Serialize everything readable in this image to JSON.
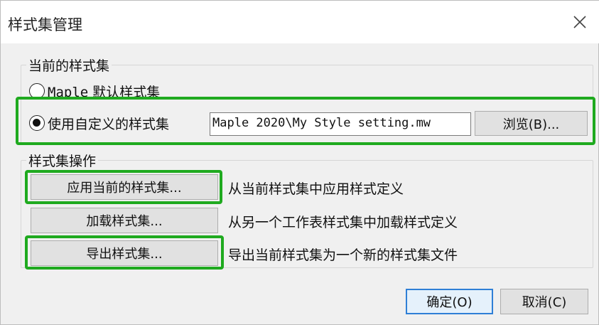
{
  "window": {
    "title": "样式集管理"
  },
  "current_style_set": {
    "group_label": "当前的样式集",
    "options": [
      {
        "label_prefix": "Maple",
        "label_suffix": " 默认样式集",
        "checked": false
      },
      {
        "label": "使用自定义的样式集",
        "checked": true
      }
    ],
    "path_value": "Maple 2020\\My Style setting.mw",
    "browse_label": "浏览(B)..."
  },
  "operations": {
    "group_label": "样式集操作",
    "items": [
      {
        "button": "应用当前的样式集...",
        "description": "从当前样式集中应用样式定义"
      },
      {
        "button": "加载样式集...",
        "description": "从另一个工作表样式集中加载样式定义"
      },
      {
        "button": "导出样式集...",
        "description": "导出当前样式集为一个新的样式集文件"
      }
    ]
  },
  "footer": {
    "ok_label": "确定(O)",
    "cancel_label": "取消(C)"
  },
  "colors": {
    "highlight": "#1faa1f",
    "default_button_border": "#2f7fd6"
  }
}
